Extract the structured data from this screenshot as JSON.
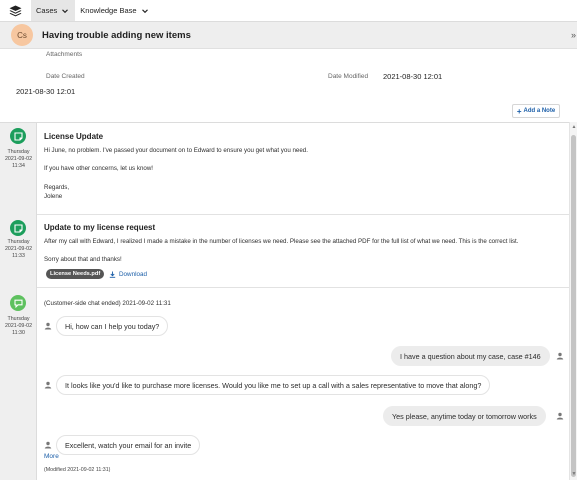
{
  "nav": {
    "logo": "layers-icon",
    "tabs": [
      {
        "label": "Cases"
      },
      {
        "label": "Knowledge Base"
      }
    ]
  },
  "header": {
    "avatar_initials": "Cs",
    "title": "Having trouble adding new items"
  },
  "details": {
    "attachments_label": "Attachments",
    "date_created_label": "Date Created",
    "date_created_value": "2021-08-30 12:01",
    "date_modified_label": "Date Modified",
    "date_modified_value": "2021-08-30 12:01",
    "add_note_label": "Add a Note"
  },
  "feed": [
    {
      "type": "email",
      "icon": "speech-bubble-icon",
      "day": "Thursday",
      "date": "2021-09-02",
      "time": "11:34",
      "title": "License Update",
      "lines": [
        "Hi June, no problem. I've passed your document on to Edward to ensure you get what you need.",
        "If you have other concerns, let us know!",
        "Regards,",
        "Jolene"
      ]
    },
    {
      "type": "email",
      "icon": "speech-bubble-icon",
      "day": "Thursday",
      "date": "2021-09-02",
      "time": "11:33",
      "title": "Update to my license request",
      "lines": [
        "After my call with Edward, I realized I made a mistake in the number of licenses we need. Please see the attached PDF for the full list of what we need. This is the correct list.",
        "Sorry about that and thanks!"
      ],
      "attachment": "License Needs.pdf",
      "download_label": "Download"
    },
    {
      "type": "chat",
      "icon": "chat-icon",
      "day": "Thursday",
      "date": "2021-09-02",
      "time": "11:30",
      "header": "(Customer-side chat ended) 2021-09-02 11:31",
      "messages": [
        {
          "from": "agent",
          "text": "Hi, how can I help you today?"
        },
        {
          "from": "customer",
          "text": "I have a question about my case, case #146"
        },
        {
          "from": "agent",
          "text": "It looks like you'd like to purchase more licenses. Would you like me to set up a call with a sales representative to move that along?"
        },
        {
          "from": "customer",
          "text": "Yes please, anytime today or tomorrow works"
        },
        {
          "from": "agent",
          "text": "Excellent, watch your email for an invite"
        }
      ],
      "more_label": "More",
      "modified": "(Modified 2021-09-02 11:31)"
    }
  ],
  "colors": {
    "accent_link": "#1b5ea8",
    "email_icon": "#1c9e5c",
    "chat_icon": "#5ec15f",
    "avatar_bg": "#f7c7a0"
  }
}
